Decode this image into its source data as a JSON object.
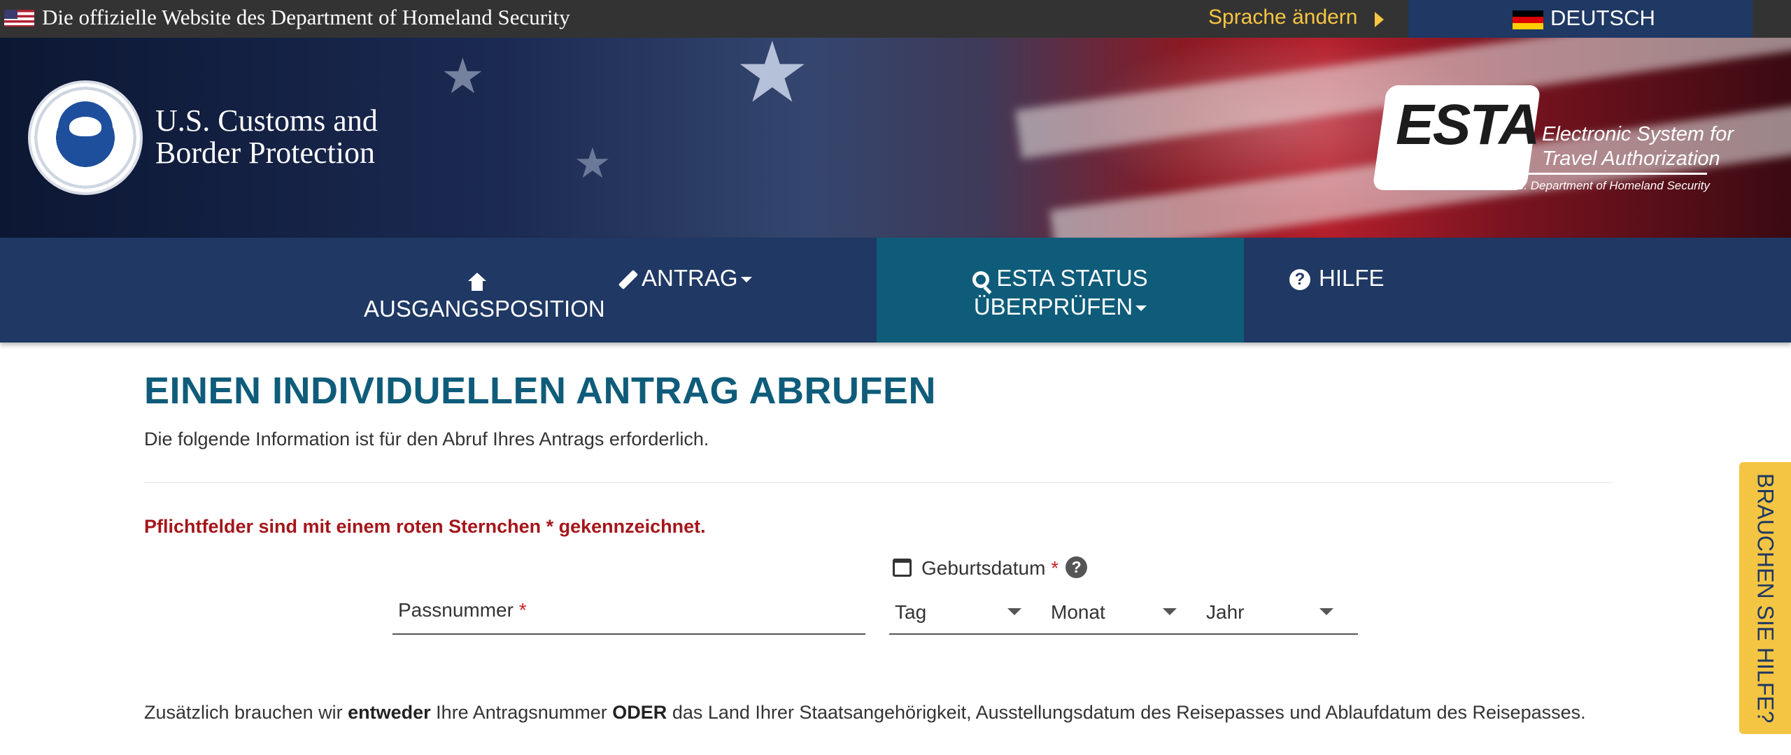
{
  "topbar": {
    "official_text": "Die offizielle Website des Department of Homeland Security",
    "change_language": "Sprache ändern",
    "current_language": "DEUTSCH"
  },
  "banner": {
    "agency_line1": "U.S. Customs and",
    "agency_line2": "Border Protection",
    "esta_logo": "ESTA",
    "esta_tagline1": "Electronic System for",
    "esta_tagline2": "Travel Authorization",
    "esta_sub": "U.S. Department of Homeland Security"
  },
  "nav": {
    "home": "AUSGANGSPOSITION",
    "application": "ANTRAG",
    "status_line1": "ESTA STATUS",
    "status_line2": "ÜBERPRÜFEN",
    "help": "HILFE"
  },
  "main": {
    "title": "EINEN INDIVIDUELLEN ANTRAG ABRUFEN",
    "intro": "Die folgende Information ist für den Abruf Ihres Antrags erforderlich.",
    "required_note": "Pflichtfelder sind mit einem roten Sternchen * gekennzeichnet.",
    "passport_label": "Passnummer",
    "dob_label": "Geburtsdatum",
    "required_marker": "*",
    "day_placeholder": "Tag",
    "month_placeholder": "Monat",
    "year_placeholder": "Jahr",
    "extra_part1": "Zusätzlich brauchen wir ",
    "extra_bold1": "entweder",
    "extra_part2": " Ihre Antragsnummer ",
    "extra_bold2": "ODER",
    "extra_part3": " das Land Ihrer Staatsangehörigkeit, Ausstellungsdatum des Reisepasses und Ablaufdatum des Reisepasses."
  },
  "help_tab": {
    "label": "BRAUCHEN SIE HILFE?"
  },
  "colors": {
    "nav_bg": "#1f3864",
    "nav_active": "#0f5c7a",
    "title": "#0f5c7a",
    "required": "#a4161a",
    "accent_yellow": "#f4c542"
  }
}
